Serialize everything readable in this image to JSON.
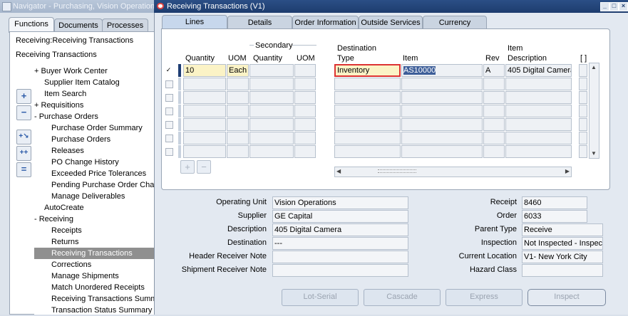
{
  "navigator": {
    "title": "Navigator - Purchasing, Vision Operations (U",
    "tabs": [
      "Functions",
      "Documents",
      "Processes"
    ],
    "breadcrumb": "Receiving:Receiving Transactions",
    "current": "Receiving Transactions",
    "items": [
      {
        "text": "+  Buyer Work Center",
        "level": 0
      },
      {
        "text": "Supplier Item Catalog",
        "level": 1
      },
      {
        "text": "Item Search",
        "level": 1
      },
      {
        "text": "+  Requisitions",
        "level": 0
      },
      {
        "text": "-  Purchase Orders",
        "level": 0
      },
      {
        "text": "Purchase Order Summary",
        "level": 2
      },
      {
        "text": "Purchase Orders",
        "level": 2
      },
      {
        "text": "Releases",
        "level": 2
      },
      {
        "text": "PO Change History",
        "level": 2
      },
      {
        "text": "Exceeded Price Tolerances",
        "level": 2
      },
      {
        "text": "Pending Purchase Order Chang",
        "level": 2
      },
      {
        "text": "Manage Deliverables",
        "level": 2
      },
      {
        "text": "AutoCreate",
        "level": 1
      },
      {
        "text": "-  Receiving",
        "level": 0
      },
      {
        "text": "Receipts",
        "level": 2
      },
      {
        "text": "Returns",
        "level": 2
      },
      {
        "text": "Receiving Transactions",
        "level": 2,
        "selected": true
      },
      {
        "text": "Corrections",
        "level": 2
      },
      {
        "text": "Manage Shipments",
        "level": 2
      },
      {
        "text": "Match Unordered Receipts",
        "level": 2
      },
      {
        "text": "Receiving Transactions Summa",
        "level": 2
      },
      {
        "text": "Transaction Status Summary",
        "level": 2
      }
    ],
    "side_icons": [
      "plus-icon",
      "minus-icon",
      "expand-branch-icon",
      "expand-all-icon",
      "collapse-all-icon"
    ]
  },
  "window": {
    "title": "Receiving Transactions (V1)",
    "controls": [
      "_",
      "□",
      "×"
    ]
  },
  "tabs": [
    "Lines",
    "Details",
    "Order Information",
    "Outside Services",
    "Currency"
  ],
  "grid": {
    "group_header": "Secondary",
    "headers": {
      "quantity": "Quantity",
      "uom": "UOM",
      "sec_quantity": "Quantity",
      "sec_uom": "UOM",
      "dest_top": "Destination",
      "dest_bottom": "Type",
      "item": "Item",
      "rev": "Rev",
      "desc_top": "Item",
      "desc_bottom": "Description",
      "flex": "[ ]"
    },
    "rows": [
      {
        "checked": "✓",
        "quantity": "10",
        "uom": "Each",
        "sec_quantity": "",
        "sec_uom": "",
        "dest_type": "Inventory",
        "item": "AS10000",
        "rev": "A",
        "description": "405 Digital Camera"
      },
      {
        "checked": "",
        "quantity": "",
        "uom": "",
        "sec_quantity": "",
        "sec_uom": "",
        "dest_type": "",
        "item": "",
        "rev": "",
        "description": ""
      },
      {
        "checked": "",
        "quantity": "",
        "uom": "",
        "sec_quantity": "",
        "sec_uom": "",
        "dest_type": "",
        "item": "",
        "rev": "",
        "description": ""
      },
      {
        "checked": "",
        "quantity": "",
        "uom": "",
        "sec_quantity": "",
        "sec_uom": "",
        "dest_type": "",
        "item": "",
        "rev": "",
        "description": ""
      },
      {
        "checked": "",
        "quantity": "",
        "uom": "",
        "sec_quantity": "",
        "sec_uom": "",
        "dest_type": "",
        "item": "",
        "rev": "",
        "description": ""
      },
      {
        "checked": "",
        "quantity": "",
        "uom": "",
        "sec_quantity": "",
        "sec_uom": "",
        "dest_type": "",
        "item": "",
        "rev": "",
        "description": ""
      },
      {
        "checked": "",
        "quantity": "",
        "uom": "",
        "sec_quantity": "",
        "sec_uom": "",
        "dest_type": "",
        "item": "",
        "rev": "",
        "description": ""
      }
    ],
    "row_buttons": [
      "+",
      "−"
    ]
  },
  "details_left": [
    {
      "label": "Operating Unit",
      "value": "Vision Operations"
    },
    {
      "label": "Supplier",
      "value": "GE Capital"
    },
    {
      "label": "Description",
      "value": "405 Digital Camera"
    },
    {
      "label": "Destination",
      "value": "---"
    },
    {
      "label": "Header Receiver Note",
      "value": ""
    },
    {
      "label": "Shipment Receiver Note",
      "value": ""
    }
  ],
  "details_right": [
    {
      "label": "Receipt",
      "value": "8460"
    },
    {
      "label": "Order",
      "value": "6033"
    },
    {
      "label": "Parent Type",
      "value": "Receive"
    },
    {
      "label": "Inspection",
      "value": "Not Inspected - Inspecti"
    },
    {
      "label": "Current Location",
      "value": "V1- New York City"
    },
    {
      "label": "Hazard Class",
      "value": ""
    }
  ],
  "buttons": {
    "lot_serial": "Lot-Serial",
    "cascade": "Cascade",
    "express": "Express",
    "inspect": "Inspect"
  },
  "colors": {
    "title_bar": "#1d3c6e",
    "required_field": "#fbf3c6",
    "selected_tree": "#8f8f8f",
    "focus_border": "#dd3333"
  }
}
